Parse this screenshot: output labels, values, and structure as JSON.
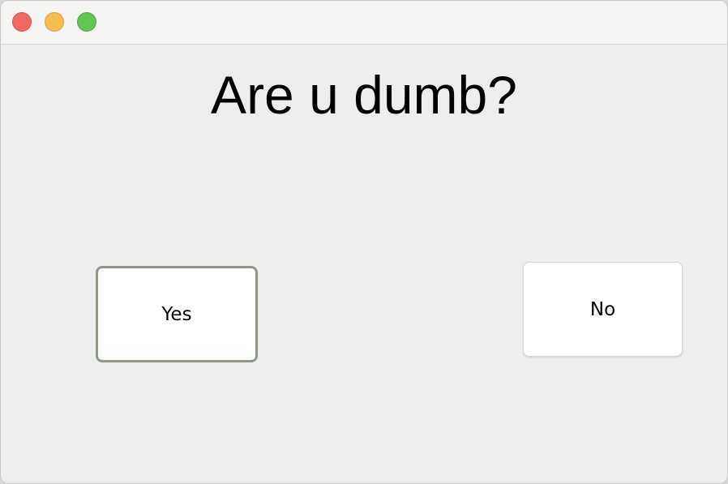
{
  "window": {
    "controls": {
      "close_icon": "close-traffic-light",
      "minimize_icon": "minimize-traffic-light",
      "zoom_icon": "zoom-traffic-light"
    }
  },
  "dialog": {
    "question": "Are u dumb?",
    "yes_label": "Yes",
    "no_label": "No"
  },
  "colors": {
    "close": "#ee6a5e",
    "minimize": "#f5be4f",
    "zoom": "#62c554",
    "background": "#eeeeee",
    "focus_border": "#8d9a88"
  }
}
